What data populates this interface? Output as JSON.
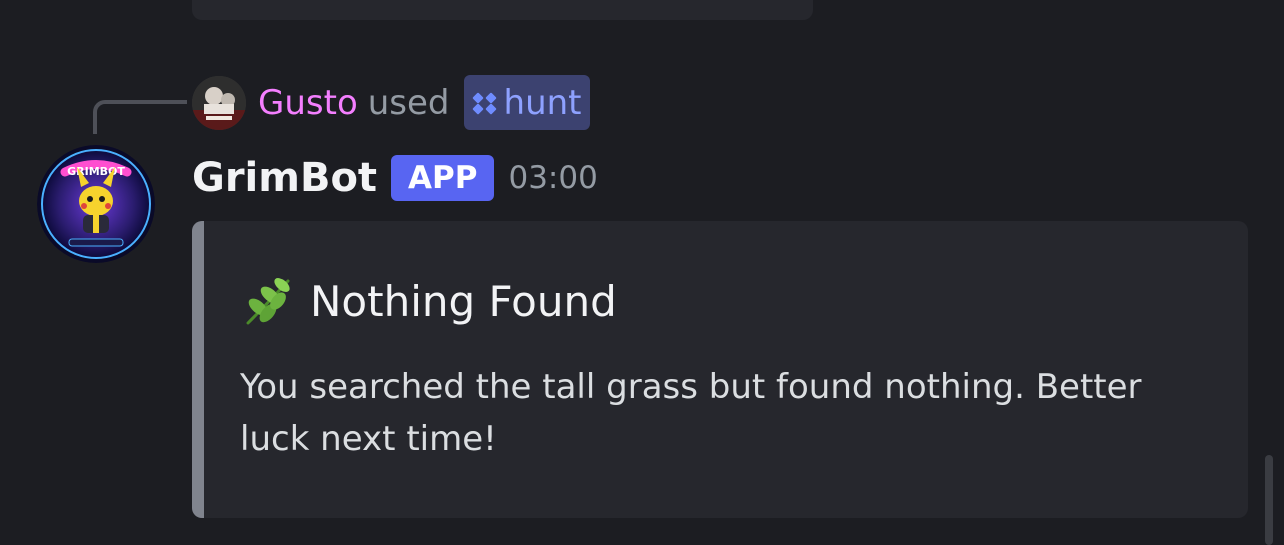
{
  "interaction": {
    "user": "Gusto",
    "verb": "used",
    "command": "hunt"
  },
  "message": {
    "author": "GrimBot",
    "badge": "APP",
    "timestamp": "03:00",
    "avatar_text": "GRIMBOT"
  },
  "embed": {
    "emoji": "🌿",
    "title": "Nothing Found",
    "description": "You searched the tall grass but found nothing. Better luck next time!",
    "accent_color": "#80848e"
  },
  "colors": {
    "background": "#1c1d22",
    "username_interaction": "#f47fff",
    "app_badge": "#5865f2",
    "command_pill": "#3c4270",
    "command_text": "#8ea1ff"
  },
  "icons": {
    "command": "app-command-icon",
    "embed_title": "herb-icon"
  }
}
